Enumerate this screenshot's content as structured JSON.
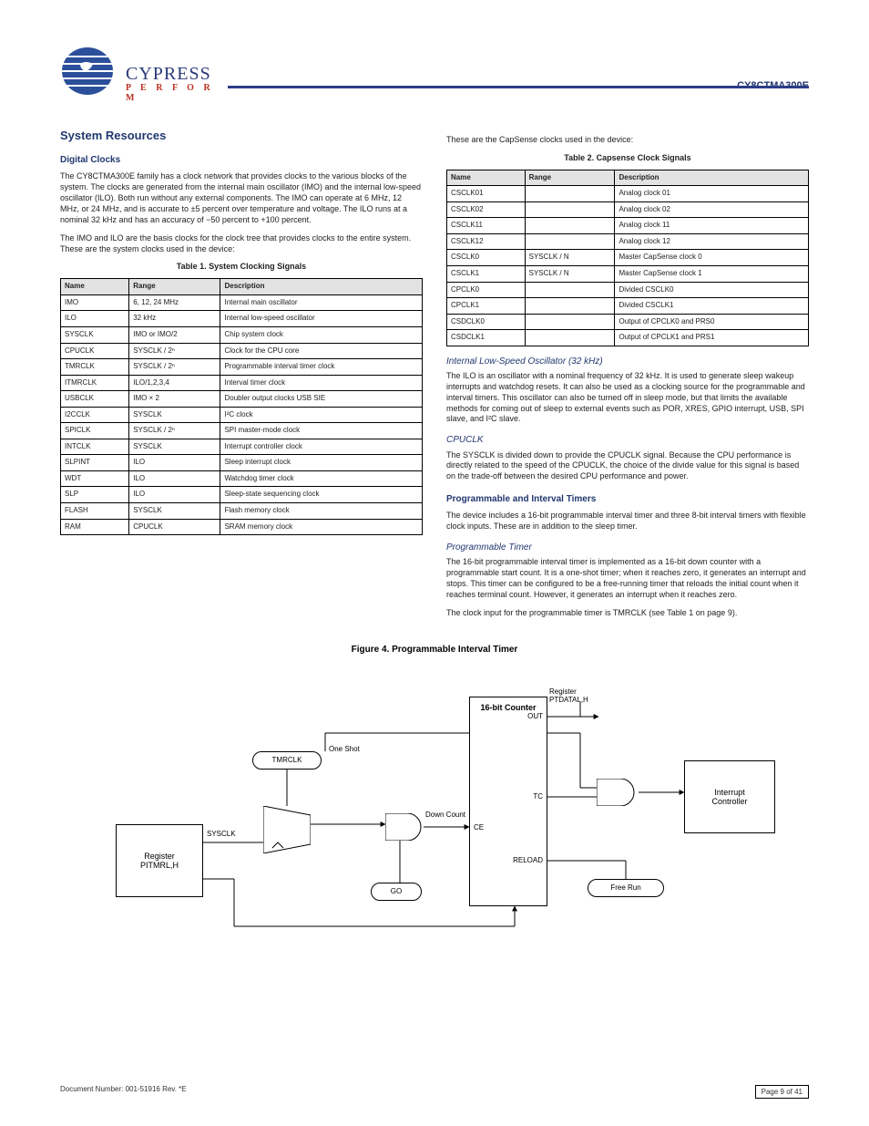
{
  "header": {
    "brand_name": "CYPRESS",
    "brand_tag": "P E R F O R M",
    "part_no": "CY8CTMA300E"
  },
  "left": {
    "h_ssc": "System Resources",
    "h_dc": "Digital Clocks",
    "p_dc1": "The CY8CTMA300E family has a clock network that provides clocks to the various blocks of the system. The clocks are generated from the internal main oscillator (IMO) and the internal low-speed oscillator (ILO). Both run without any external components. The IMO can operate at 6 MHz, 12 MHz, or 24 MHz, and is accurate to ±5 percent over temperature and voltage. The ILO runs at a nominal 32 kHz and has an accuracy of −50 percent to +100 percent.",
    "p_dc2": "The IMO and ILO are the basis clocks for the clock tree that provides clocks to the entire system. These are the system clocks used in the device:",
    "tab1_cap": "Table 1.  System Clocking Signals",
    "tab2_cap": "Table 2.  Capsense Clock Signals",
    "p_tab2_intro": "These are the CapSense clocks used in the device:"
  },
  "table1": {
    "cols": [
      "Name",
      "Range",
      "Description"
    ],
    "rows": [
      [
        "IMO",
        "6, 12, 24 MHz",
        "Internal main oscillator"
      ],
      [
        "ILO",
        "32 kHz",
        "Internal low-speed oscillator"
      ],
      [
        "SYSCLK",
        "IMO or IMO/2",
        "Chip system clock"
      ],
      [
        "CPUCLK",
        "SYSCLK / 2ⁿ",
        "Clock for the CPU core"
      ],
      [
        "TMRCLK",
        "SYSCLK / 2ⁿ",
        "Programmable interval timer clock"
      ],
      [
        "ITMRCLK",
        "ILO/1,2,3,4",
        "Interval timer clock"
      ],
      [
        "USBCLK",
        "IMO × 2",
        "Doubler output clocks USB SIE"
      ],
      [
        "I2CCLK",
        "SYSCLK",
        "I²C clock"
      ],
      [
        "SPICLK",
        "SYSCLK / 2ⁿ",
        "SPI master-mode clock"
      ],
      [
        "INTCLK",
        "SYSCLK",
        "Interrupt controller clock"
      ],
      [
        "SLPINT",
        "ILO",
        "Sleep interrupt clock"
      ],
      [
        "WDT",
        "ILO",
        "Watchdog timer clock"
      ],
      [
        "SLP",
        "ILO",
        "Sleep-state sequencing clock"
      ],
      [
        "FLASH",
        "SYSCLK",
        "Flash memory clock"
      ],
      [
        "RAM",
        "CPUCLK",
        "SRAM memory clock"
      ]
    ]
  },
  "table2": {
    "cols": [
      "Name",
      "Range",
      "Description"
    ],
    "rows": [
      [
        "CSCLK01",
        "",
        "Analog clock 01"
      ],
      [
        "CSCLK02",
        "",
        "Analog clock 02"
      ],
      [
        "CSCLK11",
        "",
        "Analog clock 11"
      ],
      [
        "CSCLK12",
        "",
        "Analog clock 12"
      ],
      [
        "CSCLK0",
        "SYSCLK / N",
        "Master CapSense clock 0"
      ],
      [
        "CSCLK1",
        "SYSCLK / N",
        "Master CapSense clock 1"
      ],
      [
        "CPCLK0",
        "",
        "Divided CSCLK0"
      ],
      [
        "CPCLK1",
        "",
        "Divided CSCLK1"
      ],
      [
        "CSDCLK0",
        "",
        "Output of CPCLK0 and PRS0"
      ],
      [
        "CSDCLK1",
        "",
        "Output of CPCLK1 and PRS1"
      ]
    ]
  },
  "right": {
    "h_ilo": "Internal Low-Speed Oscillator (32 kHz)",
    "p_ilo": "The ILO is an oscillator with a nominal frequency of 32 kHz. It is used to generate sleep wakeup interrupts and watchdog resets. It can also be used as a clocking source for the programmable and interval timers. This oscillator can also be turned off in sleep mode, but that limits the available methods for coming out of sleep to external events such as POR, XRES, GPIO interrupt, USB, SPI slave, and I²C slave.",
    "h_cpu": "CPUCLK",
    "p_cpu": "The SYSCLK is divided down to provide the CPUCLK signal. Because the CPU performance is directly related to the speed of the CPUCLK, the choice of the divide value for this signal is based on the trade-off between the desired CPU performance and power.",
    "h_prog": "Programmable and Interval Timers",
    "p_prog": "The device includes a 16-bit programmable interval timer and three 8-bit interval timers with flexible clock inputs. These are in addition to the sleep timer.",
    "h_pt": "Programmable Timer",
    "p_pt1": "The 16-bit programmable interval timer is implemented as a 16-bit down counter with a programmable start count. It is a one-shot timer; when it reaches zero, it generates an interrupt and stops. This timer can be configured to be a free-running timer that reloads the initial count when it reaches terminal count. However, it generates an interrupt when it reaches zero.",
    "p_pt2": "The clock input for the programmable timer is TMRCLK (see Table 1 on page 9)."
  },
  "figure": {
    "caption": "Figure 4.  Programmable Interval Timer",
    "sysclk": "SYSCLK",
    "tmrclk": "TMRCLK",
    "oneshot": "One Shot",
    "go": "GO",
    "freerun": "Free Run",
    "reg_pitmrl": "Register\nPITMRL,H",
    "reg_ptdatal": "Register\nPTDATAL,H",
    "counter_title": "16-bit Counter",
    "counter_out": "OUT",
    "counter_ce": "CE",
    "counter_reload": "RELOAD",
    "counter_tc": "TC",
    "downcnt": "Down Count",
    "intctrl": "Interrupt\nController"
  },
  "footer": {
    "left": "Document Number: 001-51916 Rev. *E",
    "right": "Page 9 of 41"
  }
}
